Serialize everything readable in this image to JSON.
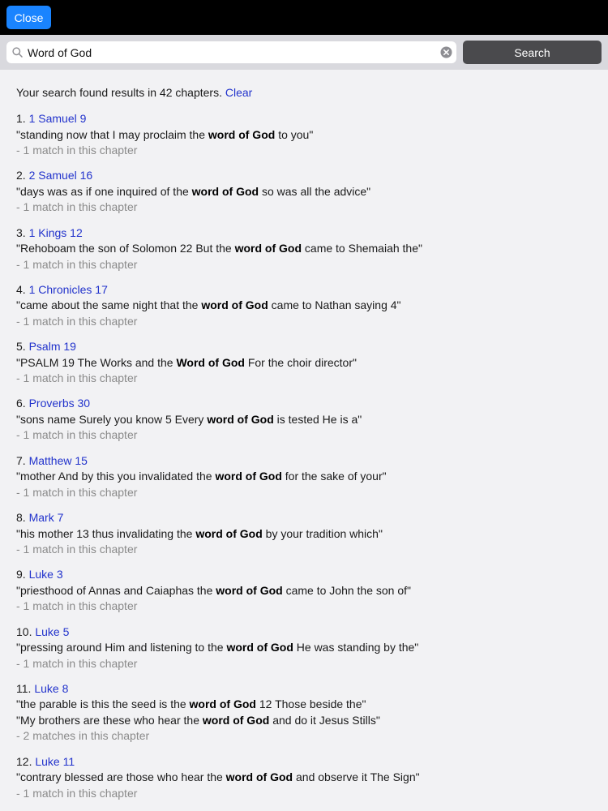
{
  "topbar": {
    "close_label": "Close"
  },
  "search": {
    "value": "Word of God",
    "placeholder": "",
    "button_label": "Search"
  },
  "summary": {
    "text": "Your search found results in 42 chapters.",
    "clear_label": "Clear"
  },
  "results": [
    {
      "num": "1.",
      "ref": "1 Samuel 9",
      "snippets": [
        {
          "before": "\"standing now that I may proclaim the ",
          "match": "word of God",
          "after": " to you\""
        }
      ],
      "count": "- 1 match in this chapter"
    },
    {
      "num": "2.",
      "ref": "2 Samuel 16",
      "snippets": [
        {
          "before": "\"days was as if one inquired of the ",
          "match": "word of God",
          "after": " so was all the advice\""
        }
      ],
      "count": "- 1 match in this chapter"
    },
    {
      "num": "3.",
      "ref": "1 Kings 12",
      "snippets": [
        {
          "before": "\"Rehoboam the son of Solomon 22 But the ",
          "match": "word of God",
          "after": " came to Shemaiah the\""
        }
      ],
      "count": "- 1 match in this chapter"
    },
    {
      "num": "4.",
      "ref": "1 Chronicles 17",
      "snippets": [
        {
          "before": "\"came about the same night that the ",
          "match": "word of God",
          "after": " came to Nathan saying 4\""
        }
      ],
      "count": "- 1 match in this chapter"
    },
    {
      "num": "5.",
      "ref": "Psalm 19",
      "snippets": [
        {
          "before": "\"PSALM 19 The Works and the ",
          "match": "Word of God",
          "after": " For the choir director\""
        }
      ],
      "count": "- 1 match in this chapter"
    },
    {
      "num": "6.",
      "ref": "Proverbs 30",
      "snippets": [
        {
          "before": "\"sons name Surely you know 5 Every ",
          "match": "word of God",
          "after": " is tested He is a\""
        }
      ],
      "count": "- 1 match in this chapter"
    },
    {
      "num": "7.",
      "ref": "Matthew 15",
      "snippets": [
        {
          "before": "\"mother And by this you invalidated the ",
          "match": "word of God",
          "after": " for the sake of your\""
        }
      ],
      "count": "- 1 match in this chapter"
    },
    {
      "num": "8.",
      "ref": "Mark 7",
      "snippets": [
        {
          "before": "\"his mother 13 thus invalidating the ",
          "match": "word of God",
          "after": " by your tradition which\""
        }
      ],
      "count": "- 1 match in this chapter"
    },
    {
      "num": "9.",
      "ref": "Luke 3",
      "snippets": [
        {
          "before": "\"priesthood of Annas and Caiaphas the ",
          "match": "word of God",
          "after": " came to John the son of\""
        }
      ],
      "count": "- 1 match in this chapter"
    },
    {
      "num": "10.",
      "ref": "Luke 5",
      "snippets": [
        {
          "before": "\"pressing around Him and listening to the ",
          "match": "word of God",
          "after": " He was standing by the\""
        }
      ],
      "count": "- 1 match in this chapter"
    },
    {
      "num": "11.",
      "ref": "Luke 8",
      "snippets": [
        {
          "before": "\"the parable is this the seed is the ",
          "match": "word of God",
          "after": " 12 Those beside the\""
        },
        {
          "before": "\"My brothers are these who hear the ",
          "match": "word of God",
          "after": " and do it Jesus Stills\""
        }
      ],
      "count": "- 2 matches in this chapter"
    },
    {
      "num": "12.",
      "ref": "Luke 11",
      "snippets": [
        {
          "before": "\"contrary blessed are those who hear the ",
          "match": "word of God",
          "after": " and observe it The Sign\""
        }
      ],
      "count": "- 1 match in this chapter"
    }
  ],
  "icons": {
    "search": "magnifier-icon",
    "clear": "clear-circle-icon"
  },
  "colors": {
    "topbar": "#000000",
    "close_button": "#1a84ff",
    "search_button": "#4a4a4d",
    "link": "#2233cc",
    "meta": "#8a8a8a"
  }
}
